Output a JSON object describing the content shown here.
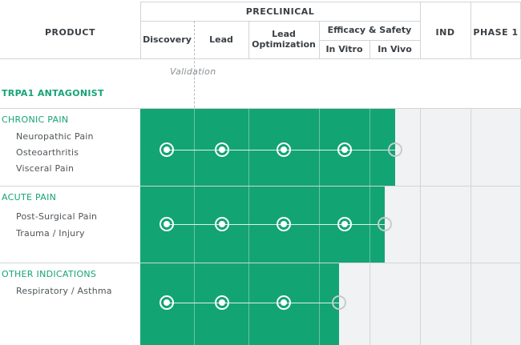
{
  "header": {
    "product": "PRODUCT",
    "preclinical": "PRECLINICAL",
    "discovery": "Discovery",
    "lead": "Lead",
    "lead_opt": "Lead\nOptimization",
    "efficacy": "Efficacy & Safety",
    "in_vitro": "In Vitro",
    "in_vivo": "In Vivo",
    "ind": "IND",
    "phase1": "PHASE 1"
  },
  "validation_label": "Validation",
  "product_title": "TRPA1 ANTAGONIST",
  "colors": {
    "accent": "#13a474",
    "accent_text": "#16a377",
    "grid": "#d2d4d6",
    "shade": "#f1f2f3"
  },
  "rows": [
    {
      "category": "CHRONIC PAIN",
      "indications": [
        "Neuropathic Pain",
        "Osteoarthritis",
        "Visceral Pain"
      ],
      "progress_stage": 4.5,
      "filled_milestones": 4
    },
    {
      "category": "ACUTE PAIN",
      "indications": [
        "Post-Surgical Pain",
        "Trauma / Injury"
      ],
      "progress_stage": 4.3,
      "filled_milestones": 4
    },
    {
      "category": "OTHER INDICATIONS",
      "indications": [
        "Respiratory / Asthma"
      ],
      "progress_stage": 3.4,
      "filled_milestones": 3
    }
  ]
}
